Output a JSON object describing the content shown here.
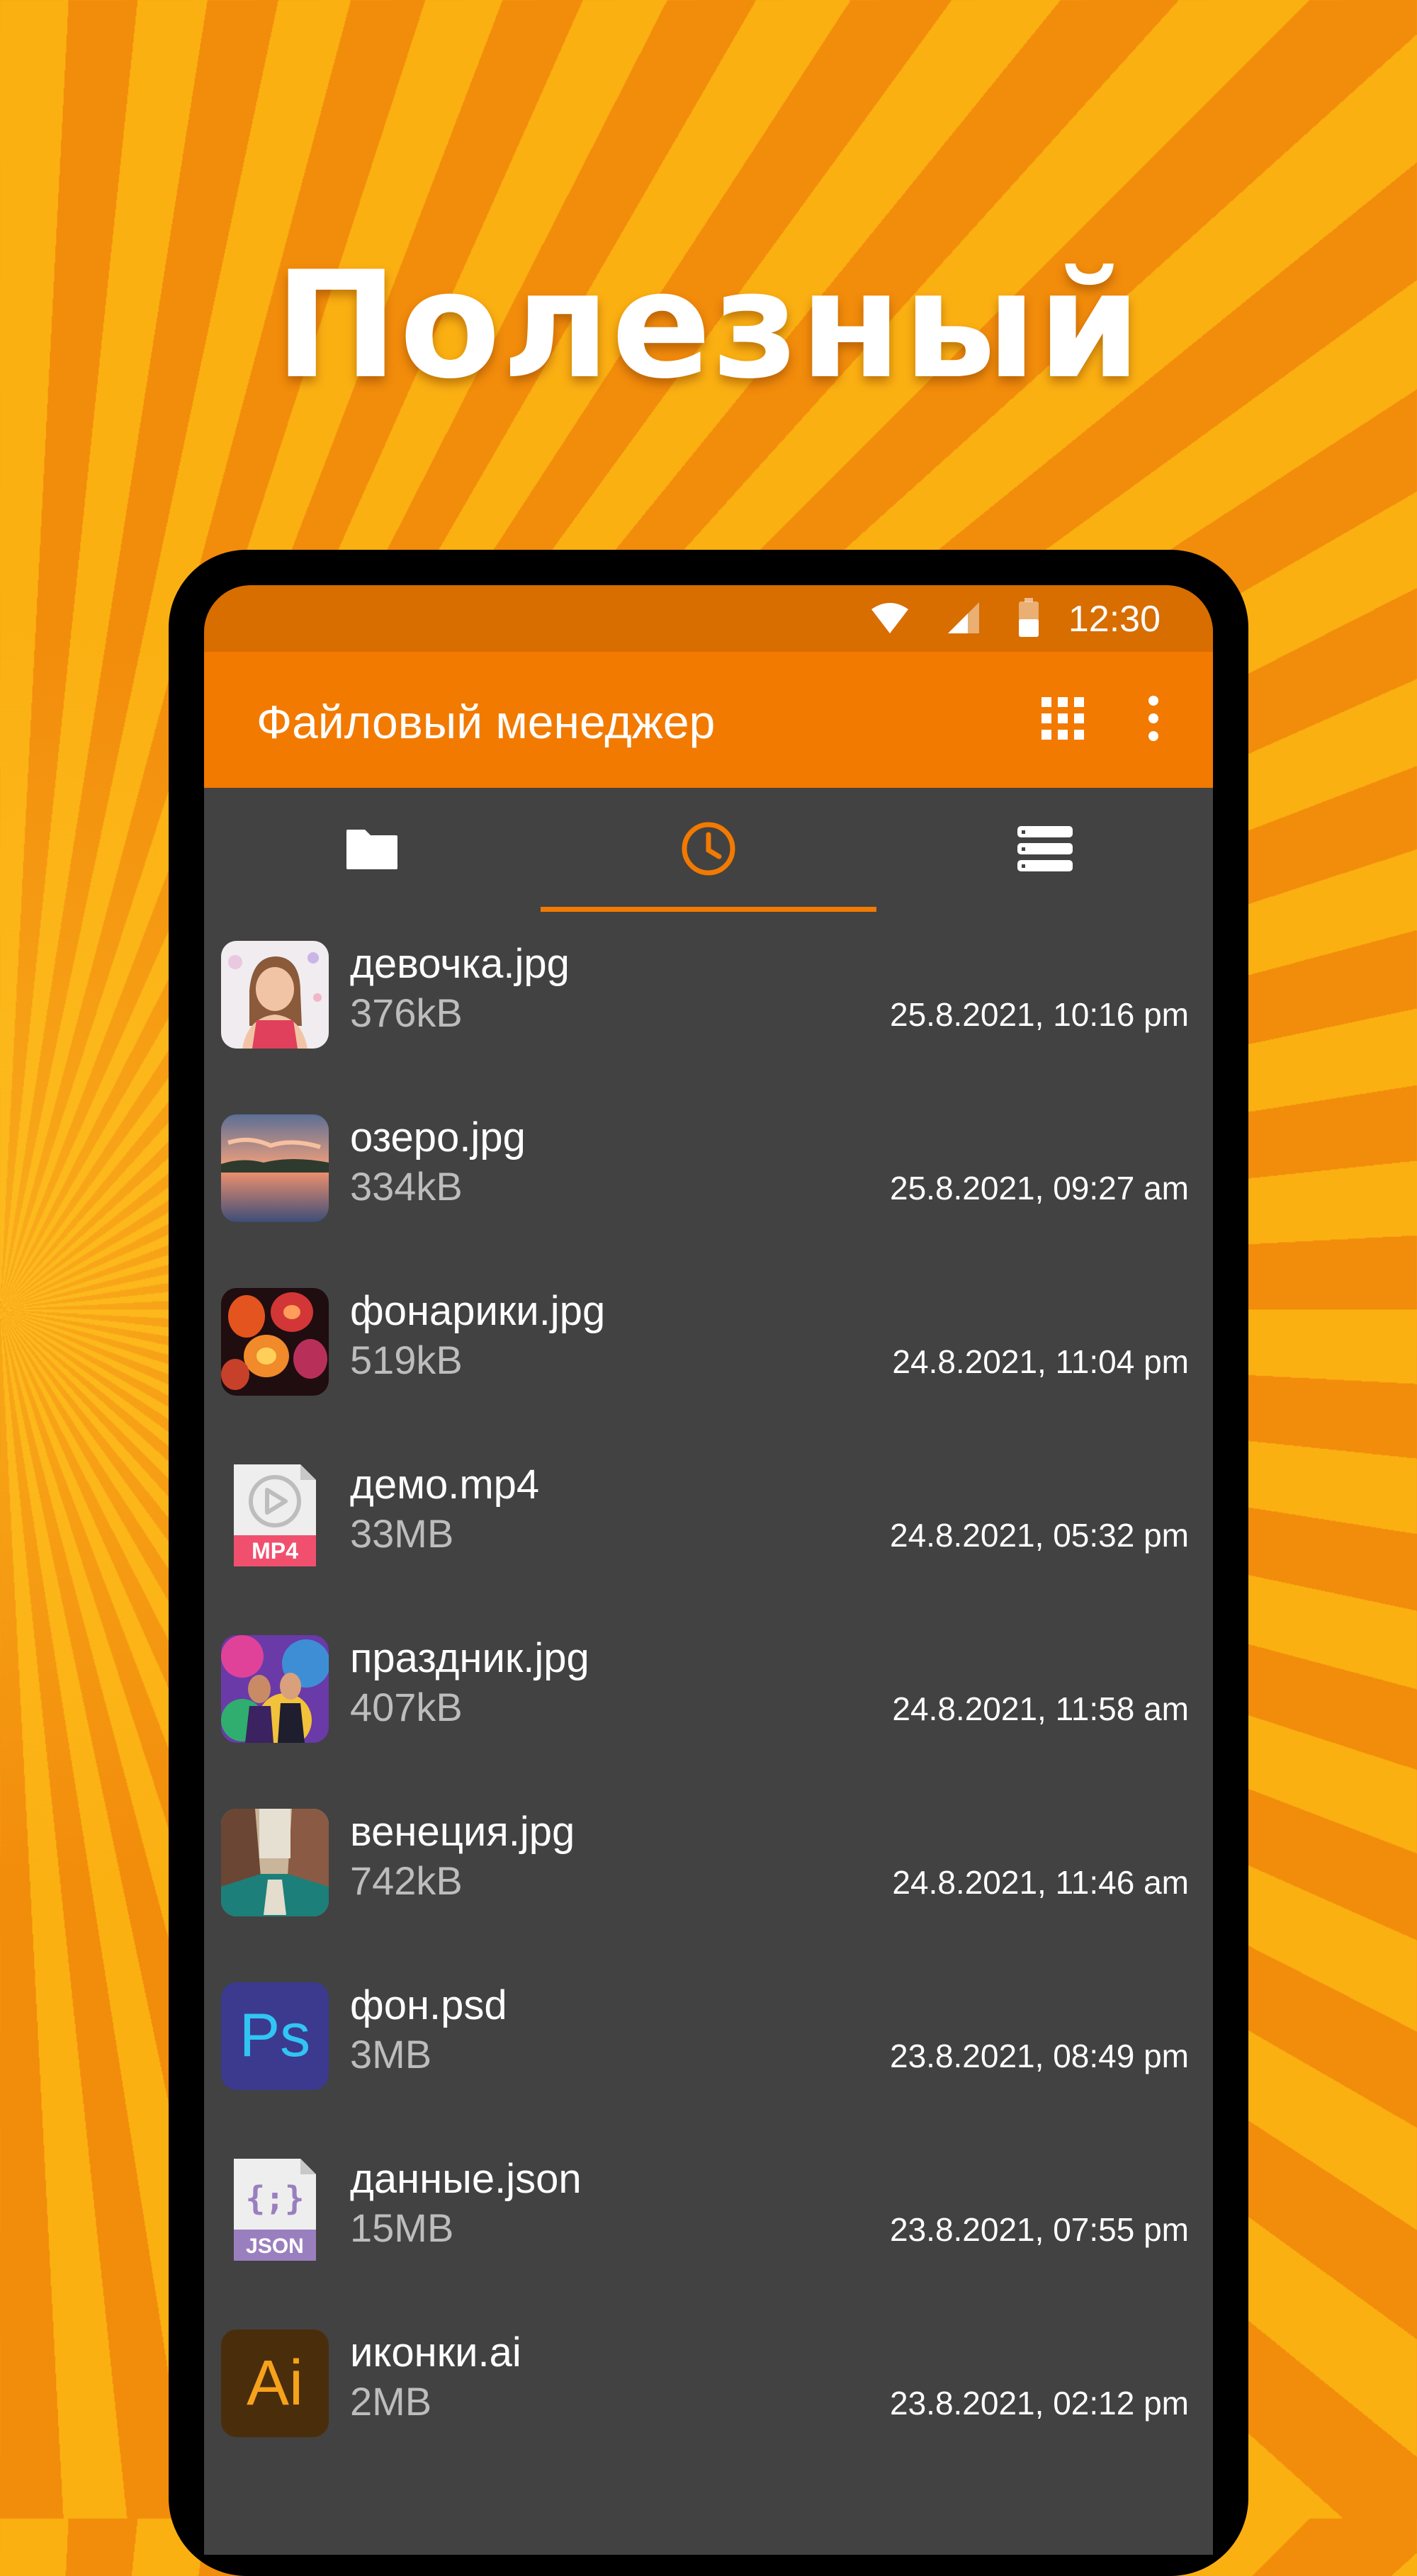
{
  "promo": {
    "headline": "Полезный"
  },
  "status_bar": {
    "time": "12:30",
    "icons": [
      "wifi-icon",
      "cell-signal-icon",
      "battery-icon"
    ]
  },
  "app_bar": {
    "title": "Файловый менеджер",
    "actions": [
      "grid-view-icon",
      "more-vertical-icon"
    ],
    "color": "#f27a00",
    "status_color": "#d86d00"
  },
  "tabs": [
    {
      "icon": "folder-icon",
      "selected": false
    },
    {
      "icon": "clock-icon",
      "selected": true
    },
    {
      "icon": "storage-icon",
      "selected": false
    }
  ],
  "accent_color": "#f27a00",
  "files": [
    {
      "name": "девочка.jpg",
      "size": "376kB",
      "date": "25.8.2021, 10:16 pm",
      "icon": "girl-photo-thumbnail"
    },
    {
      "name": "озеро.jpg",
      "size": "334kB",
      "date": "25.8.2021, 09:27 am",
      "icon": "lake-photo-thumbnail"
    },
    {
      "name": "фонарики.jpg",
      "size": "519kB",
      "date": "24.8.2021, 11:04 pm",
      "icon": "lanterns-photo-thumbnail"
    },
    {
      "name": "демо.mp4",
      "size": "33MB",
      "date": "24.8.2021, 05:32 pm",
      "icon": "mp4-file-icon",
      "badge": "MP4"
    },
    {
      "name": "праздник.jpg",
      "size": "407kB",
      "date": "24.8.2021, 11:58 am",
      "icon": "holiday-photo-thumbnail"
    },
    {
      "name": "венеция.jpg",
      "size": "742kB",
      "date": "24.8.2021, 11:46 am",
      "icon": "venice-photo-thumbnail"
    },
    {
      "name": "фон.psd",
      "size": "3MB",
      "date": "23.8.2021, 08:49 pm",
      "icon": "photoshop-icon",
      "badge": "Ps"
    },
    {
      "name": "данные.json",
      "size": "15MB",
      "date": "23.8.2021, 07:55 pm",
      "icon": "json-file-icon",
      "badge": "JSON",
      "glyph": "{;}"
    },
    {
      "name": "иконки.ai",
      "size": "2MB",
      "date": "23.8.2021, 02:12 pm",
      "icon": "illustrator-icon",
      "badge": "Ai"
    }
  ]
}
